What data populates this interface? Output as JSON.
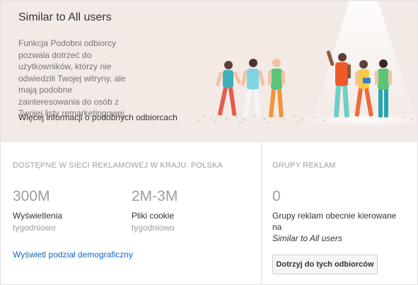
{
  "hero": {
    "title": "Similar to All users",
    "description": "Funkcja Podobni odbiorcy pozwala dotrzeć do użytkowników, którzy nie odwiedzili Twojej witryny, ale mają podobne zainteresowania do osób z Twojej listy remarketingowej.",
    "more_info_link": "Więcej informacji o podobnych odbiorcach"
  },
  "availability": {
    "heading": "Dostępne w sieci reklamowej w kraju: Polska",
    "impressions": {
      "value": "300M",
      "label": "Wyświetlenia",
      "period": "tygodniowo"
    },
    "cookies": {
      "value": "2M-3M",
      "label": "Pliki cookie",
      "period": "tygodniowo"
    },
    "demographics_link": "Wyświetl podział demograficzny"
  },
  "ad_groups": {
    "heading": "Grupy reklam",
    "count": "0",
    "description_prefix": "Grupy reklam obecnie kierowane na",
    "audience_name": "Similar to All users",
    "button_label": "Dotrzyj do tych odbiorców"
  }
}
